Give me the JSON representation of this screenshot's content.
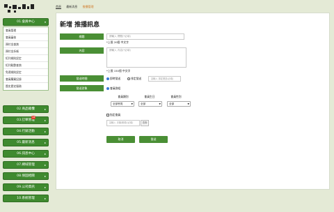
{
  "sidebar": {
    "menus": [
      {
        "label": "01.會員中心",
        "expanded": true
      },
      {
        "label": "02.商品總攬",
        "expanded": false
      },
      {
        "label": "03.訂單管理",
        "expanded": false,
        "badge": "14"
      },
      {
        "label": "04.行銷活動",
        "expanded": false
      },
      {
        "label": "05.最新消息",
        "expanded": false
      },
      {
        "label": "06.訊息中心",
        "expanded": false
      },
      {
        "label": "07.網域管理",
        "expanded": false
      },
      {
        "label": "08.保固相關",
        "expanded": false
      },
      {
        "label": "09.公司資訊",
        "expanded": false
      },
      {
        "label": "10.系統管理",
        "expanded": false
      }
    ],
    "submenu": [
      "會員管理",
      "會員審核",
      "預付金查詢",
      "預付金折帳",
      "紅利規則設定",
      "紅利點數查詢",
      "免運規則設定",
      "會員購買記錄",
      "歷史歷史服務"
    ]
  },
  "breadcrumb": {
    "home": "首頁",
    "section": "最新消息",
    "current": "推播管理"
  },
  "page_title": "新增 推播訊息",
  "form": {
    "title_label": "標題",
    "title_placeholder": "請輸入 標題(*必填)",
    "title_hint": "*上限 20個 中文字",
    "content_label": "內容",
    "content_placeholder": "請輸入 內容(*必填)",
    "content_hint": "*上限 150個 中文字",
    "time_label": "發送時間",
    "time_now": "即時發送",
    "time_scheduled": "排定發送",
    "time_placeholder": "請輸入 排定發送(必填)",
    "target_label": "發送對象",
    "target_group": "會員群組",
    "col_category": "會員類別",
    "col_birthday": "會員生日",
    "col_gender": "會員性別",
    "sel_category": "全部會員",
    "sel_birthday": "全部",
    "sel_gender": "全部",
    "specific_member": "指定會員",
    "member_placeholder": "請輸入 手機/帳號/(必填)",
    "member_btn": "查詢",
    "cancel_btn": "取消",
    "send_btn": "發送"
  },
  "colors": {
    "accent": "#4a8f35",
    "menu_bg": "#3f8a2f",
    "active_crumb": "#d07a28",
    "badge": "#e23a2b"
  }
}
